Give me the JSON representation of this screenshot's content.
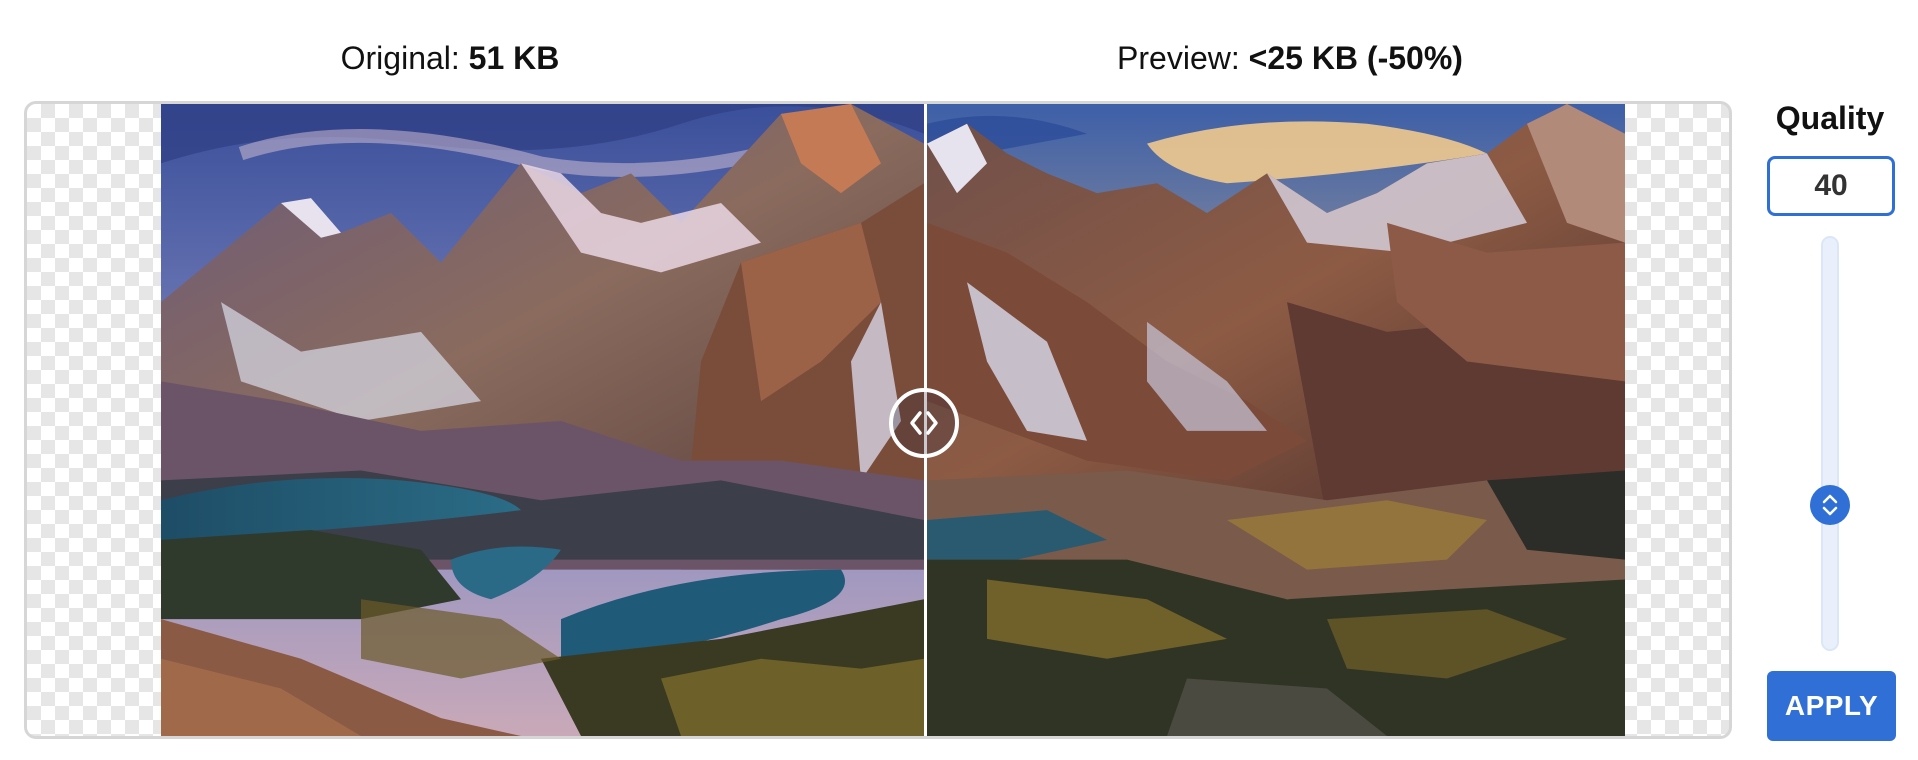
{
  "header": {
    "original_prefix": "Original: ",
    "original_size": "51 KB",
    "preview_prefix": "Preview: ",
    "preview_size": "<25 KB (-50%)"
  },
  "controls": {
    "quality_label": "Quality",
    "quality_value": "40",
    "quality_slider_level": 0.4,
    "apply_label": "APPLY"
  },
  "colors": {
    "accent": "#2f6fd6",
    "frame_border": "#d6d6d6",
    "checker": "#e6e6e6"
  },
  "icons": {
    "compare_handle": "chevrons-left-right-icon",
    "slider_thumb": "chevrons-up-down-icon"
  }
}
